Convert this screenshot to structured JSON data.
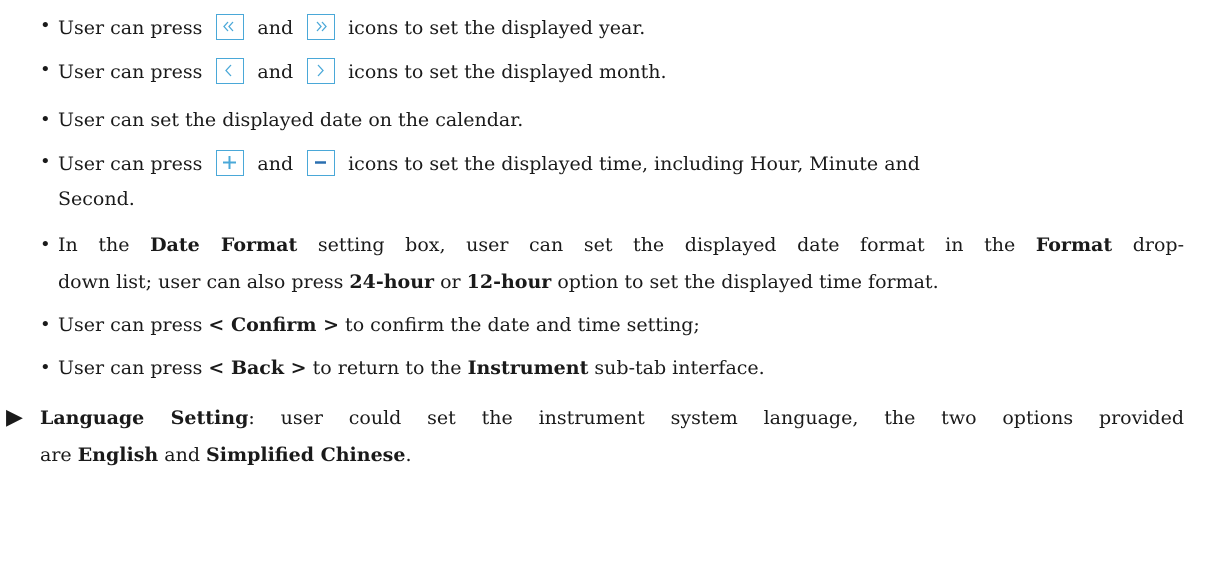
{
  "bullets": [
    {
      "pre": "User can press",
      "mid": "and",
      "post": "icons to set the displayed year.",
      "icons": [
        "double-left-arrow-icon",
        "double-right-arrow-icon"
      ]
    },
    {
      "pre": "User can press",
      "mid": "and",
      "post": "icons to set the displayed month.",
      "icons": [
        "left-arrow-icon",
        "right-arrow-icon"
      ]
    },
    {
      "text": "User can set the displayed date on the calendar."
    },
    {
      "pre": "User can press",
      "mid": "and",
      "post": "icons to set the displayed time, including Hour, Minute and",
      "line2": "Second.",
      "icons": [
        "plus-icon",
        "minus-icon"
      ]
    },
    {
      "t1": "In the ",
      "b1": "Date Format",
      "t2": " setting box, user can set the displayed date format in the ",
      "b2": "Format",
      "t3": " drop-",
      "l2t1": "down list; user can also press ",
      "l2b1": "24-hour",
      "l2t2": " or ",
      "l2b2": "12-hour",
      "l2t3": " option to set the displayed time format."
    },
    {
      "t1": "User can press ",
      "b1": "< Confirm >",
      "t2": " to confirm the date and time setting;"
    },
    {
      "t1": "User can press ",
      "b1": "< Back >",
      "t2": " to return to the ",
      "b2": "Instrument",
      "t3": " sub-tab interface."
    }
  ],
  "language": {
    "b1": "Language Setting",
    "t1": ": user could set the instrument system language, the two options provided",
    "l2t1": "are ",
    "l2b1": "English",
    "l2t2": " and ",
    "l2b2": "Simplified Chinese",
    "l2t3": "."
  },
  "icon_color": "#4aa8d8",
  "bullet_glyph": "•",
  "arrow_glyph": "▶"
}
